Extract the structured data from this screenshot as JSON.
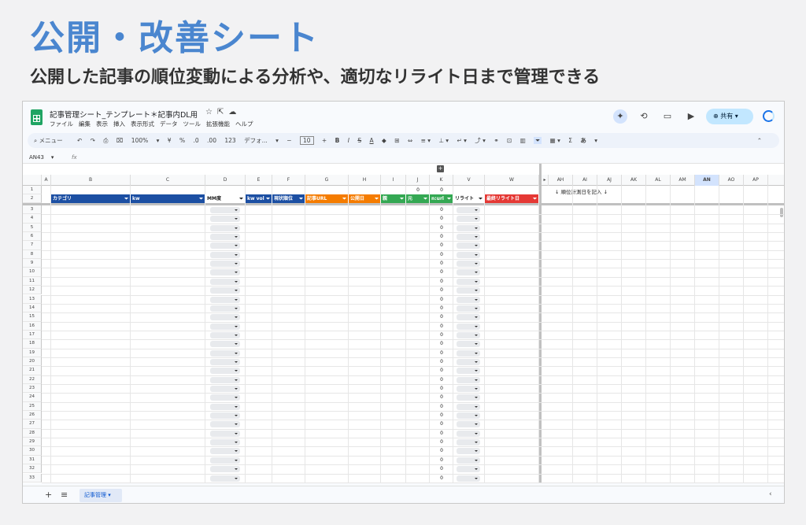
{
  "hero": {
    "title": "公開・改善シート",
    "subtitle": "公開した記事の順位変動による分析や、適切なリライト日まで管理できる"
  },
  "doc": {
    "title": "記事管理シート_テンプレート＊記事内DL用",
    "title_icons": [
      "star-icon",
      "move-icon",
      "cloud-icon"
    ]
  },
  "menu": [
    "ファイル",
    "編集",
    "表示",
    "挿入",
    "表示形式",
    "データ",
    "ツール",
    "拡張機能",
    "ヘルプ"
  ],
  "share": {
    "label": "共有"
  },
  "toolbar": {
    "search": "メニュー",
    "zoom": "100%",
    "currency": "¥",
    "percent": "%",
    "dec_minus": ".0",
    "dec_plus": ".00",
    "numfmt": "123",
    "font": "デフォ...",
    "font_size": "10",
    "minus": "−",
    "plus": "+",
    "bold": "B",
    "italic": "I",
    "strike": "S",
    "textcolor": "A",
    "sigma": "Σ",
    "ime": "あ"
  },
  "formula_bar": {
    "cell": "AN43",
    "fx": "fx"
  },
  "grid": {
    "columns": [
      "A",
      "B",
      "C",
      "D",
      "E",
      "F",
      "G",
      "H",
      "I",
      "J",
      "K",
      "V",
      "W"
    ],
    "right_columns": [
      "AH",
      "AI",
      "AJ",
      "AK",
      "AL",
      "AM",
      "AN",
      "AO",
      "AP"
    ],
    "headers": {
      "category": "カテゴリ",
      "kw": "kw",
      "mm": "MM度",
      "kwvol": "kw vol",
      "rank": "現状順位",
      "url": "記事URL",
      "pubdate": "公開日",
      "parent": "親",
      "origin": "元",
      "nurl": "n:url",
      "rewrite": "リライト",
      "lastrewrite": "最終リライト日"
    },
    "row1_j": "0",
    "row1_k": "0",
    "k_value": "0",
    "note": "↓ 順位計測日を記入 ↓",
    "colors": {
      "blue": "#1c4fa3",
      "lightblue": "#3c78d8",
      "orange": "#f57c00",
      "green": "#34a853",
      "red": "#e53935"
    }
  },
  "sheet_tab": {
    "label": "記事管理"
  }
}
